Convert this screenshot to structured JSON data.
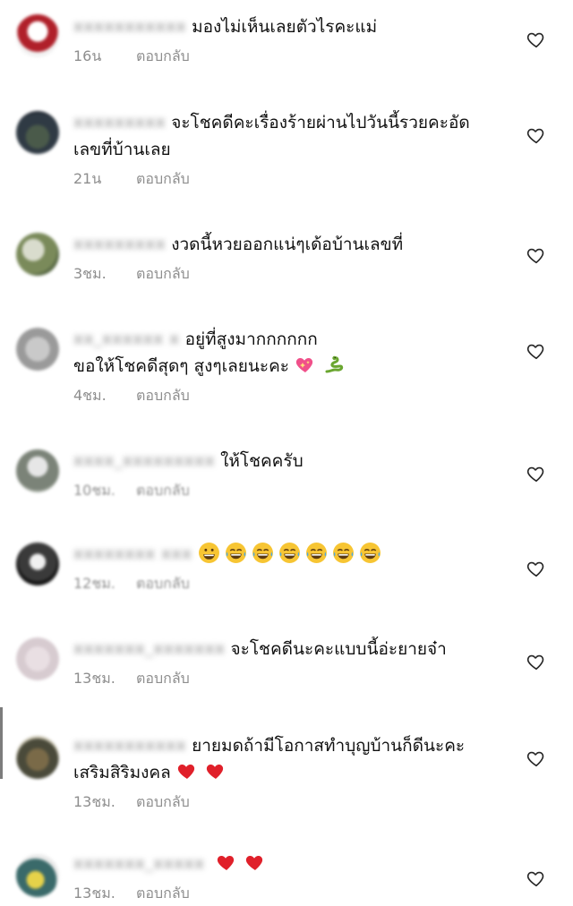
{
  "comments": [
    {
      "username": "xxxxxxxxxxx",
      "text": "มองไม่เห็นเลยตัวไรคะแม่",
      "text2": "",
      "time": "16น",
      "reply": "ตอบกลับ"
    },
    {
      "username": "xxxxxxxxx",
      "text": "จะโชคดีคะเรื่องร้ายผ่านไปวันนี้รวยคะอัด",
      "text2": "เลขที่บ้านเลย",
      "time": "21น",
      "reply": "ตอบกลับ"
    },
    {
      "username": "xxxxxxxxx",
      "text": "งวดนี้หวยออกแน่ๆเด้อบ้านเลขที่",
      "text2": "",
      "time": "3ชม.",
      "reply": "ตอบกลับ"
    },
    {
      "username": "xx_xxxxxx x",
      "text": "อยู่ที่สูงมากกกกกก",
      "text2": "ขอให้โชคดีสุดๆ สูงๆเลยนะคะ",
      "time": "4ชม.",
      "reply": "ตอบกลับ"
    },
    {
      "username": "xxxx_xxxxxxxxx",
      "text": "ให้โชคครับ",
      "text2": "",
      "time": "10ชม.",
      "reply": "ตอบกลับ"
    },
    {
      "username": "xxxxxxxx xxx",
      "text": "",
      "text2": "",
      "time": "12ชม.",
      "reply": "ตอบกลับ"
    },
    {
      "username": "xxxxxxx_xxxxxxx",
      "text": "จะโชคดีนะคะแบบนี้อ่ะยายจ๋า",
      "text2": "",
      "time": "13ชม.",
      "reply": "ตอบกลับ"
    },
    {
      "username": "xxxxxxxxxxx",
      "text": "ยายมดถ้ามีโอกาสทำบุญบ้านก็ดีนะคะ",
      "text2": "เสริมสิริมงคล",
      "time": "13ชม.",
      "reply": "ตอบกลับ"
    },
    {
      "username": "xxxxxxx_xxxxx",
      "text": "",
      "text2": "",
      "time": "13ชม.",
      "reply": "ตอบกลับ"
    }
  ],
  "colors": {
    "text": "#111111",
    "meta": "#8e8e8e",
    "heart_outline": "#262626",
    "heart_emoji": "#e0202a"
  },
  "icons": {
    "like": "heart-outline-icon",
    "emoji_red_heart": "red-heart-emoji",
    "emoji_sparkle_heart": "sparkling-heart-emoji",
    "emoji_snake": "snake-emoji",
    "emoji_grin": "grinning-face-emoji",
    "emoji_tears": "tears-of-joy-emoji"
  }
}
